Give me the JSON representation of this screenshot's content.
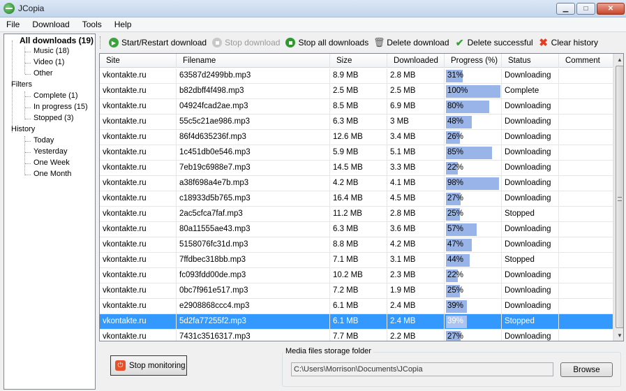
{
  "window": {
    "title": "JCopia",
    "min_glyph": "▁",
    "max_glyph": "□",
    "close_glyph": "✕"
  },
  "menu": [
    "File",
    "Download",
    "Tools",
    "Help"
  ],
  "sidebar": {
    "all_downloads": "All downloads (19)",
    "types": [
      "Music (18)",
      "Video (1)",
      "Other"
    ],
    "filters_label": "Filters",
    "filters": [
      "Complete (1)",
      "In progress (15)",
      "Stopped (3)"
    ],
    "history_label": "History",
    "history": [
      "Today",
      "Yesterday",
      "One Week",
      "One Month"
    ]
  },
  "toolbar": {
    "start_restart": "Start/Restart download",
    "stop": "Stop download",
    "stop_all": "Stop all downloads",
    "delete": "Delete download",
    "delete_successful": "Delete successful",
    "clear_history": "Clear history"
  },
  "table": {
    "columns": [
      "Site",
      "Filename",
      "Size",
      "Downloaded",
      "Progress (%)",
      "Status",
      "Comment"
    ],
    "rows": [
      {
        "site": "vkontakte.ru",
        "filename": "63587d2499bb.mp3",
        "size": "8.9 MB",
        "downloaded": "2.8 MB",
        "progress": 31,
        "progress_label": "31%",
        "status": "Downloading",
        "comment": ""
      },
      {
        "site": "vkontakte.ru",
        "filename": "b82dbff4f498.mp3",
        "size": "2.5 MB",
        "downloaded": "2.5 MB",
        "progress": 100,
        "progress_label": "100%",
        "status": "Complete",
        "comment": ""
      },
      {
        "site": "vkontakte.ru",
        "filename": "04924fcad2ae.mp3",
        "size": "8.5 MB",
        "downloaded": "6.9 MB",
        "progress": 80,
        "progress_label": "80%",
        "status": "Downloading",
        "comment": ""
      },
      {
        "site": "vkontakte.ru",
        "filename": "55c5c21ae986.mp3",
        "size": "6.3 MB",
        "downloaded": "3 MB",
        "progress": 48,
        "progress_label": "48%",
        "status": "Downloading",
        "comment": ""
      },
      {
        "site": "vkontakte.ru",
        "filename": "86f4d635236f.mp3",
        "size": "12.6 MB",
        "downloaded": "3.4 MB",
        "progress": 26,
        "progress_label": "26%",
        "status": "Downloading",
        "comment": ""
      },
      {
        "site": "vkontakte.ru",
        "filename": "1c451db0e546.mp3",
        "size": "5.9 MB",
        "downloaded": "5.1 MB",
        "progress": 85,
        "progress_label": "85%",
        "status": "Downloading",
        "comment": ""
      },
      {
        "site": "vkontakte.ru",
        "filename": "7eb19c6988e7.mp3",
        "size": "14.5 MB",
        "downloaded": "3.3 MB",
        "progress": 22,
        "progress_label": "22%",
        "status": "Downloading",
        "comment": ""
      },
      {
        "site": "vkontakte.ru",
        "filename": "a38f698a4e7b.mp3",
        "size": "4.2 MB",
        "downloaded": "4.1 MB",
        "progress": 98,
        "progress_label": "98%",
        "status": "Downloading",
        "comment": ""
      },
      {
        "site": "vkontakte.ru",
        "filename": "c18933d5b765.mp3",
        "size": "16.4 MB",
        "downloaded": "4.5 MB",
        "progress": 27,
        "progress_label": "27%",
        "status": "Downloading",
        "comment": ""
      },
      {
        "site": "vkontakte.ru",
        "filename": "2ac5cfca7faf.mp3",
        "size": "11.2 MB",
        "downloaded": "2.8 MB",
        "progress": 25,
        "progress_label": "25%",
        "status": "Stopped",
        "comment": ""
      },
      {
        "site": "vkontakte.ru",
        "filename": "80a11555ae43.mp3",
        "size": "6.3 MB",
        "downloaded": "3.6 MB",
        "progress": 57,
        "progress_label": "57%",
        "status": "Downloading",
        "comment": ""
      },
      {
        "site": "vkontakte.ru",
        "filename": "5158076fc31d.mp3",
        "size": "8.8 MB",
        "downloaded": "4.2 MB",
        "progress": 47,
        "progress_label": "47%",
        "status": "Downloading",
        "comment": ""
      },
      {
        "site": "vkontakte.ru",
        "filename": "7ffdbec318bb.mp3",
        "size": "7.1 MB",
        "downloaded": "3.1 MB",
        "progress": 44,
        "progress_label": "44%",
        "status": "Stopped",
        "comment": ""
      },
      {
        "site": "vkontakte.ru",
        "filename": "fc093fdd00de.mp3",
        "size": "10.2 MB",
        "downloaded": "2.3 MB",
        "progress": 22,
        "progress_label": "22%",
        "status": "Downloading",
        "comment": ""
      },
      {
        "site": "vkontakte.ru",
        "filename": "0bc7f961e517.mp3",
        "size": "7.2 MB",
        "downloaded": "1.9 MB",
        "progress": 25,
        "progress_label": "25%",
        "status": "Downloading",
        "comment": ""
      },
      {
        "site": "vkontakte.ru",
        "filename": "e2908868ccc4.mp3",
        "size": "6.1 MB",
        "downloaded": "2.4 MB",
        "progress": 39,
        "progress_label": "39%",
        "status": "Downloading",
        "comment": ""
      },
      {
        "site": "vkontakte.ru",
        "filename": "5d2fa77255f2.mp3",
        "size": "6.1 MB",
        "downloaded": "2.4 MB",
        "progress": 39,
        "progress_label": "39%",
        "status": "Stopped",
        "comment": "",
        "selected": true
      },
      {
        "site": "vkontakte.ru",
        "filename": "7431c3516317.mp3",
        "size": "7.7 MB",
        "downloaded": "2.2 MB",
        "progress": 27,
        "progress_label": "27%",
        "status": "Downloading",
        "comment": ""
      }
    ]
  },
  "bottom": {
    "stop_monitoring": "Stop monitoring",
    "folder_legend": "Media files storage folder",
    "folder_path": "C:\\Users\\Morrison\\Documents\\JCopia",
    "browse": "Browse"
  },
  "colors": {
    "progress_fill": "#99b4e8",
    "selection": "#3399ff"
  }
}
